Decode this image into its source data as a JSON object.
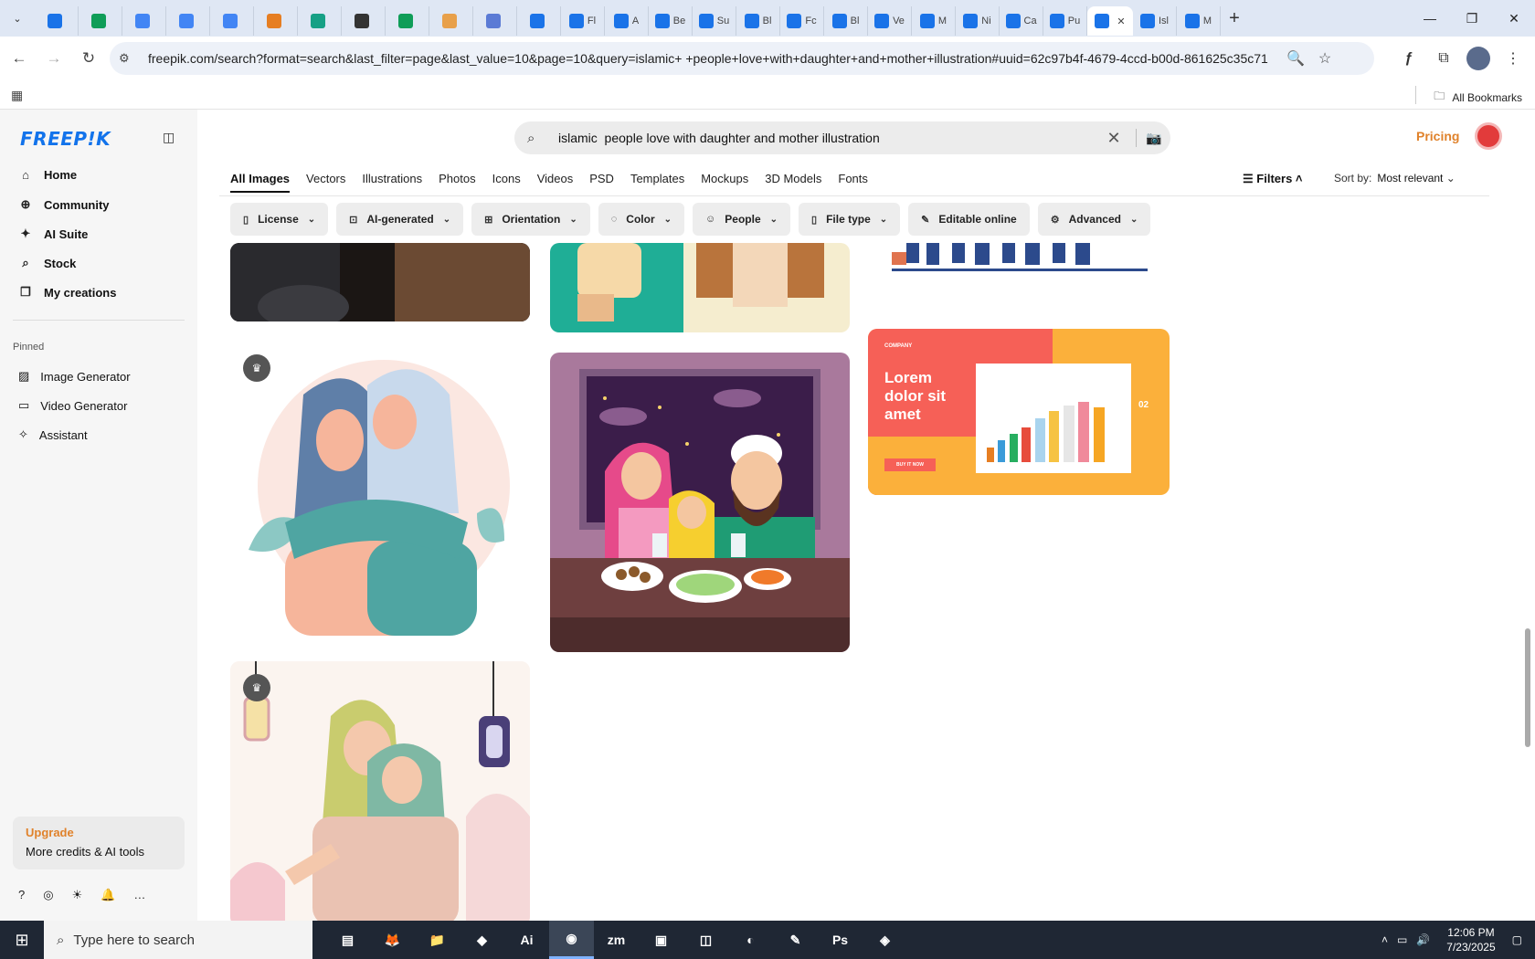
{
  "browser": {
    "tabs": [
      {
        "title": "",
        "color": "#1a73e8"
      },
      {
        "title": "",
        "color": "#0f9d58"
      },
      {
        "title": "",
        "color": "#4285f4"
      },
      {
        "title": "",
        "color": "#4285f4"
      },
      {
        "title": "",
        "color": "#4285f4"
      },
      {
        "title": "",
        "color": "#e67e22"
      },
      {
        "title": "",
        "color": "#16a085"
      },
      {
        "title": "",
        "color": "#333333"
      },
      {
        "title": "",
        "color": "#0f9d58"
      },
      {
        "title": "",
        "color": "#e8a04a"
      },
      {
        "title": "",
        "color": "#5b7bd5"
      },
      {
        "title": "",
        "color": "#1a73e8"
      },
      {
        "title": "Fl",
        "color": "#1a73e8"
      },
      {
        "title": "A",
        "color": "#1a73e8"
      },
      {
        "title": "Be",
        "color": "#1a73e8"
      },
      {
        "title": "Su",
        "color": "#1a73e8"
      },
      {
        "title": "Bl",
        "color": "#1a73e8"
      },
      {
        "title": "Fc",
        "color": "#1a73e8"
      },
      {
        "title": "Bl",
        "color": "#1a73e8"
      },
      {
        "title": "Ve",
        "color": "#1a73e8"
      },
      {
        "title": "M",
        "color": "#1a73e8"
      },
      {
        "title": "Ni",
        "color": "#1a73e8"
      },
      {
        "title": "Ca",
        "color": "#1a73e8"
      },
      {
        "title": "Pu",
        "color": "#1a73e8"
      },
      {
        "title": "",
        "color": "#1a73e8",
        "active": true
      },
      {
        "title": "Isl",
        "color": "#1a73e8"
      },
      {
        "title": "M",
        "color": "#1a73e8"
      }
    ],
    "url": "freepik.com/search?format=search&last_filter=page&last_value=10&page=10&query=islamic+ +people+love+with+daughter+and+mother+illustration#uuid=62c97b4f-4679-4ccd-b00d-861625c35c71",
    "bookmarks_label": "All Bookmarks"
  },
  "sidebar": {
    "logo": "FREEP!K",
    "nav": [
      "Home",
      "Community",
      "AI Suite",
      "Stock",
      "My creations"
    ],
    "pinned_label": "Pinned",
    "pinned": [
      "Image Generator",
      "Video Generator",
      "Assistant"
    ],
    "upgrade_title": "Upgrade",
    "upgrade_sub": "More credits & AI tools"
  },
  "header": {
    "search_query": "islamic  people love with daughter and mother illustration",
    "pricing": "Pricing"
  },
  "tabs": [
    "All Images",
    "Vectors",
    "Illustrations",
    "Photos",
    "Icons",
    "Videos",
    "PSD",
    "Templates",
    "Mockups",
    "3D Models",
    "Fonts"
  ],
  "filters_label": "Filters",
  "sort": {
    "label": "Sort by:",
    "value": "Most relevant"
  },
  "chips": [
    "License",
    "AI-generated",
    "Orientation",
    "Color",
    "People",
    "File type",
    "Editable online",
    "Advanced"
  ],
  "banner": {
    "company": "COMPANY",
    "headline_1": "Lorem",
    "headline_2": "dolor sit",
    "headline_3": "amet",
    "button": "BUY IT NOW",
    "page": "02"
  },
  "taskbar": {
    "search_placeholder": "Type here to search",
    "time": "12:06 PM",
    "date": "7/23/2025",
    "apps": [
      "▤",
      "🦊",
      "📁",
      "◆",
      "Ai",
      "◉",
      "zm",
      "▣",
      "◫",
      "◐",
      "✎",
      "Ps",
      "◈"
    ]
  }
}
